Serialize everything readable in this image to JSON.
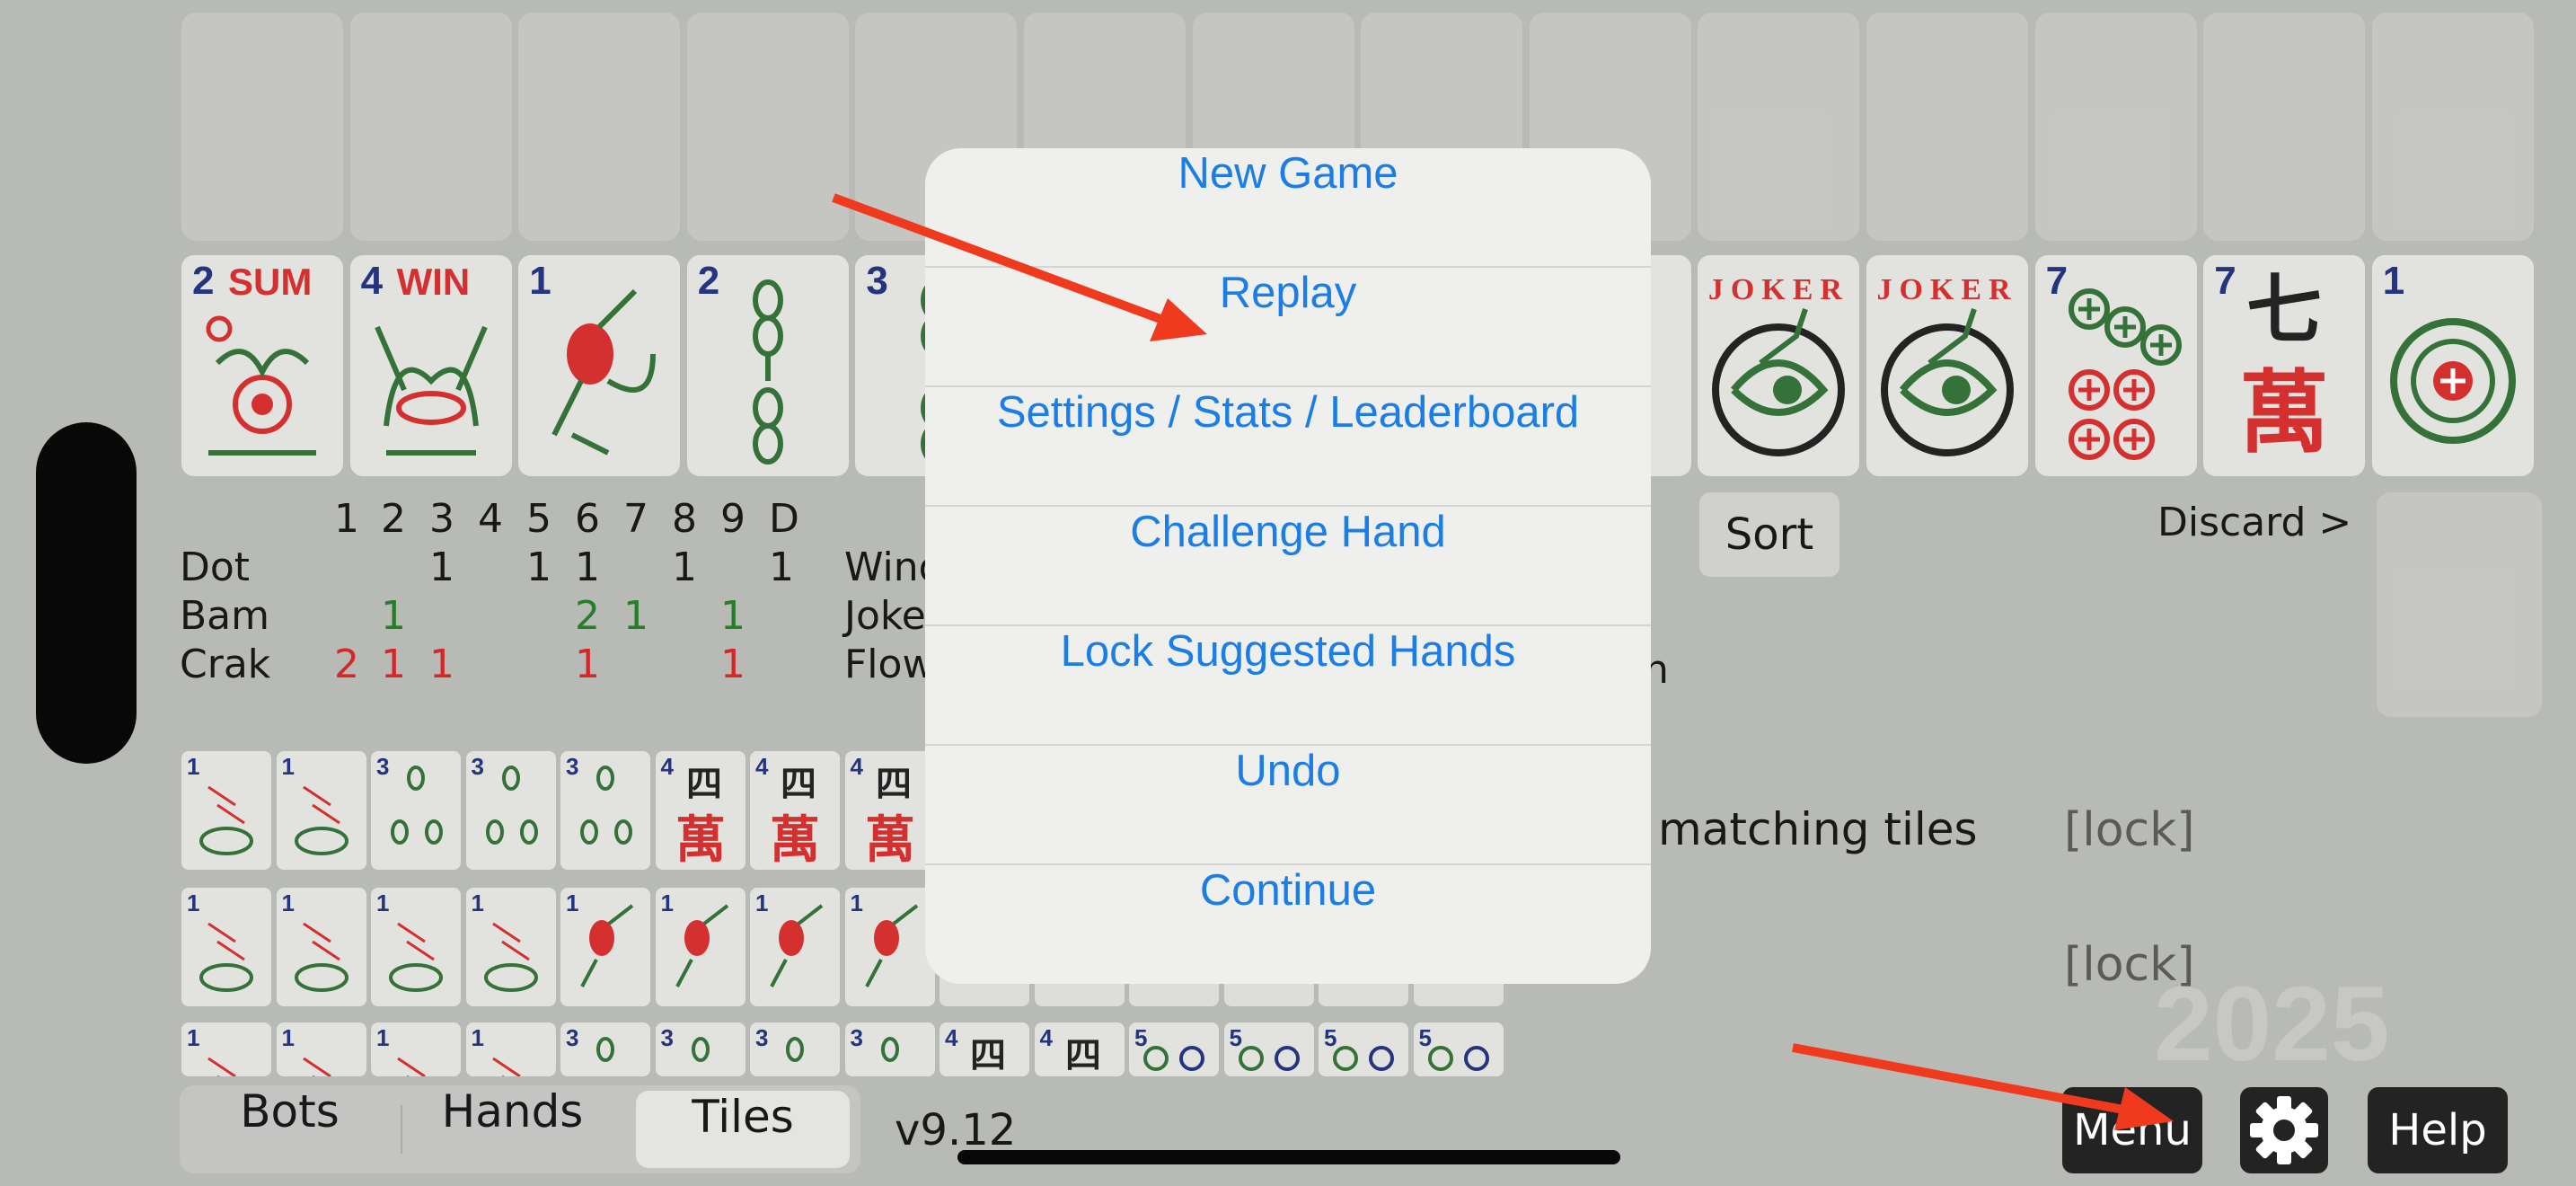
{
  "top_tiles": [
    {
      "num": "2",
      "word": "SUM",
      "kind": "flower"
    },
    {
      "num": "4",
      "word": "WIN",
      "kind": "flower2"
    },
    {
      "num": "1",
      "word": "",
      "kind": "bird"
    },
    {
      "num": "2",
      "word": "",
      "kind": "bam"
    },
    {
      "num": "3",
      "word": "",
      "kind": "bam"
    },
    {
      "num": "",
      "word": "",
      "kind": "hidden"
    },
    {
      "num": "",
      "word": "",
      "kind": "hidden"
    },
    {
      "num": "",
      "word": "",
      "kind": "hidden"
    },
    {
      "num": "",
      "word": "",
      "kind": "bam-edge"
    },
    {
      "num": "",
      "word": "JOKER",
      "kind": "joker"
    },
    {
      "num": "",
      "word": "JOKER",
      "kind": "joker"
    },
    {
      "num": "7",
      "word": "",
      "kind": "dot7"
    },
    {
      "num": "7",
      "word": "七",
      "kind": "crak",
      "char2": "萬"
    },
    {
      "num": "1",
      "word": "",
      "kind": "dot1"
    }
  ],
  "count_table": {
    "headers": [
      "1",
      "2",
      "3",
      "4",
      "5",
      "6",
      "7",
      "8",
      "9",
      "D"
    ],
    "rows": [
      {
        "label": "Dot",
        "color": "#111111",
        "cells": [
          "",
          "",
          "1",
          "",
          "1",
          "1",
          "",
          "1",
          "",
          "1"
        ]
      },
      {
        "label": "Bam",
        "color": "#1f7a1f",
        "cells": [
          "",
          "1",
          "",
          "",
          "",
          "2",
          "1",
          "",
          "1",
          ""
        ]
      },
      {
        "label": "Crak",
        "color": "#d42020",
        "cells": [
          "2",
          "1",
          "1",
          "",
          "",
          "1",
          "",
          "",
          "1",
          ""
        ]
      }
    ],
    "extra_labels": [
      "Wind",
      "Joke",
      "Flow"
    ]
  },
  "sort_label": "Sort",
  "discard_label": "Discard >",
  "hand_rows": [
    {
      "text": "matching tiles",
      "lock": "[lock]"
    },
    {
      "text": "",
      "lock": "[lock]"
    }
  ],
  "year_watermark": "2025",
  "tab_bar": {
    "tabs": [
      {
        "label": "Bots",
        "selected": false
      },
      {
        "label": "Hands",
        "selected": false
      },
      {
        "label": "Tiles",
        "selected": true
      }
    ]
  },
  "version": "v9.12",
  "menu_button": "Menu",
  "help_button": "Help",
  "menu": {
    "items": [
      "New Game",
      "Replay",
      "Settings / Stats / Leaderboard",
      "Challenge Hand",
      "Lock Suggested Hands",
      "Undo",
      "Continue"
    ]
  },
  "colors": {
    "accent": "#1a7ee6",
    "arrow": "#f03a1e",
    "background": "#b6b8b3"
  },
  "icons": {
    "settings": "gear-icon"
  },
  "small_tile_rows": [
    [
      "1",
      "1",
      "3",
      "3",
      "3",
      "4",
      "4",
      "4"
    ],
    [
      "1",
      "1",
      "1",
      "1",
      "1",
      "1",
      "1",
      "1"
    ],
    [
      "1",
      "1",
      "1",
      "1",
      "3",
      "3",
      "3",
      "3",
      "4",
      "4",
      "5",
      "5",
      "5",
      "5"
    ]
  ],
  "small_tile_rows_hidden_part": [
    [
      "",
      "",
      "",
      "",
      "",
      ""
    ],
    [
      "",
      "",
      "",
      "",
      "",
      ""
    ]
  ]
}
